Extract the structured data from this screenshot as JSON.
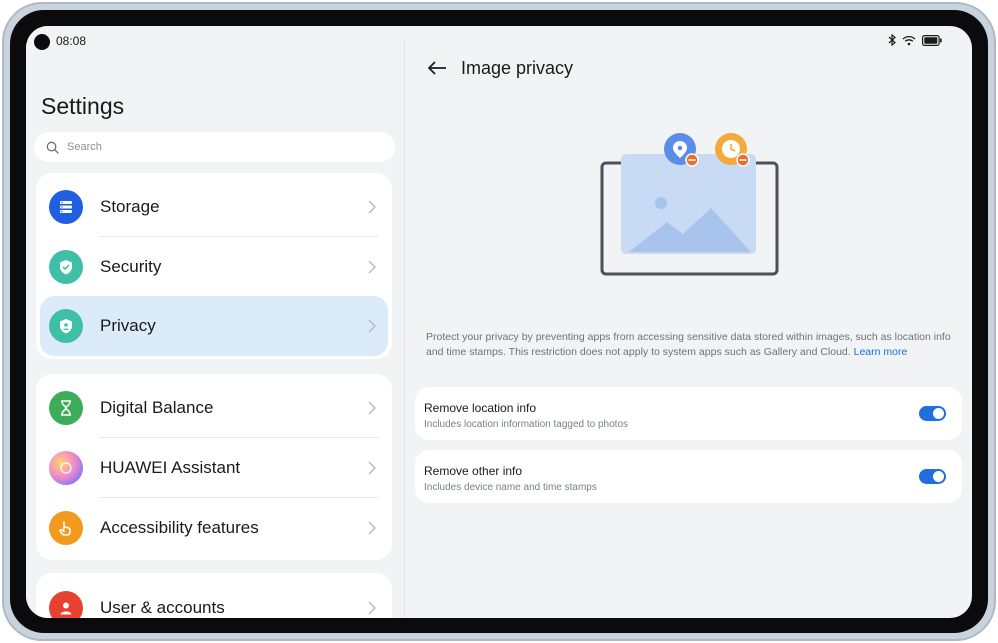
{
  "status_bar": {
    "time": "08:08"
  },
  "left": {
    "title": "Settings",
    "search": {
      "placeholder": "Search"
    },
    "groups": [
      {
        "items": [
          {
            "label": "Storage",
            "icon": "storage-icon",
            "color": "#1f5fe0"
          },
          {
            "label": "Security",
            "icon": "shield-check-icon",
            "color": "#3fbfa8"
          },
          {
            "label": "Privacy",
            "icon": "privacy-shield-icon",
            "color": "#3fbfa8",
            "selected": true
          }
        ]
      },
      {
        "items": [
          {
            "label": "Digital Balance",
            "icon": "hourglass-icon",
            "color": "#3cae5b"
          },
          {
            "label": "HUAWEI Assistant",
            "icon": "assistant-icon",
            "color": "#8e7bf0"
          },
          {
            "label": "Accessibility features",
            "icon": "hand-icon",
            "color": "#f39a1e"
          }
        ]
      },
      {
        "items": [
          {
            "label": "User & accounts",
            "icon": "user-icon",
            "color": "#e8412f"
          }
        ]
      }
    ]
  },
  "right": {
    "title": "Image privacy",
    "description": "Protect your privacy by preventing apps from accessing sensitive data stored within images, such as location info and time stamps. This restriction does not apply to system apps such as Gallery and Cloud.",
    "learn_more": "Learn more",
    "options": [
      {
        "title": "Remove location info",
        "subtitle": "Includes location information tagged to photos",
        "enabled": true
      },
      {
        "title": "Remove other info",
        "subtitle": "Includes device name and time stamps",
        "enabled": true
      }
    ]
  },
  "colors": {
    "accent": "#1f6fe0",
    "selected_bg": "#dcebfa",
    "link": "#1a6fd9"
  }
}
